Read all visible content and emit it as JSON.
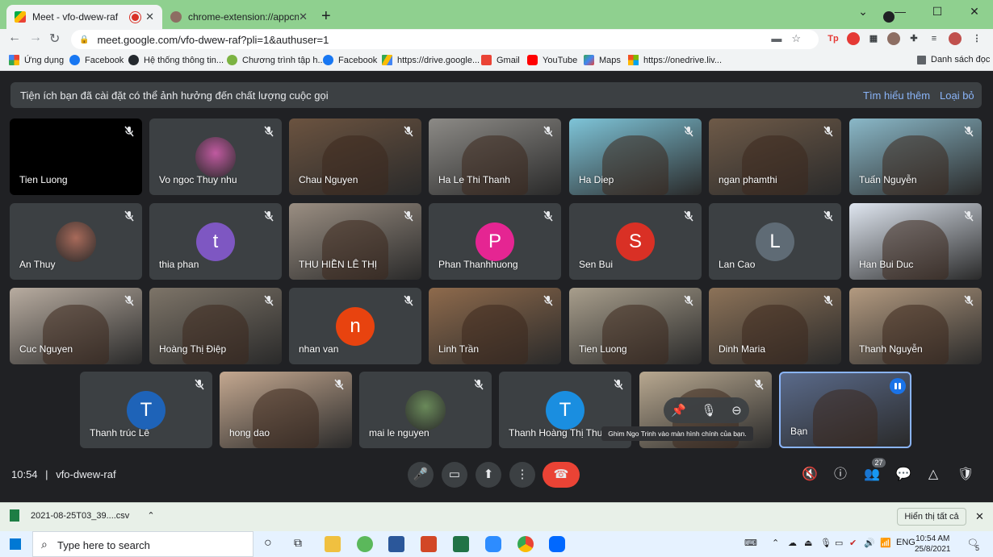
{
  "browser": {
    "tabs": [
      {
        "title": "Meet - vfo-dwew-raf",
        "icon": "meet-icon",
        "recording": true
      },
      {
        "title": "chrome-extension://appcnhiefoic",
        "icon": "extension-icon"
      }
    ],
    "url": "meet.google.com/vfo-dwew-raf?pli=1&authuser=1",
    "extension_labels": {
      "tp": "Tp"
    },
    "bookmarks": [
      {
        "label": "Ứng dụng",
        "icon": "apps-grid-icon",
        "color": "#ea4335"
      },
      {
        "label": "Facebook",
        "icon": "facebook-icon",
        "color": "#1877f2"
      },
      {
        "label": "Hệ thống thông tin...",
        "icon": "github-icon",
        "color": "#24292e"
      },
      {
        "label": "Chương trình tập h...",
        "icon": "leaf-icon",
        "color": "#7cb342"
      },
      {
        "label": "Facebook",
        "icon": "facebook-icon",
        "color": "#1877f2"
      },
      {
        "label": "https://drive.google...",
        "icon": "drive-icon",
        "color": "#fbbc04"
      },
      {
        "label": "Gmail",
        "icon": "gmail-icon",
        "color": "#ea4335"
      },
      {
        "label": "YouTube",
        "icon": "youtube-icon",
        "color": "#ff0000"
      },
      {
        "label": "Maps",
        "icon": "maps-icon",
        "color": "#34a853"
      },
      {
        "label": "https://onedrive.liv...",
        "icon": "microsoft-icon",
        "color": "#f25022"
      }
    ],
    "reading_list": "Danh sách đọc"
  },
  "meet": {
    "banner": {
      "message": "Tiện ích bạn đã cài đặt có thể ảnh hưởng đến chất lượng cuộc gọi",
      "learn_more": "Tìm hiểu thêm",
      "dismiss": "Loại bỏ"
    },
    "participants": [
      {
        "name": "Tien Luong",
        "kind": "black"
      },
      {
        "name": "Vo ngoc Thuy nhu",
        "kind": "photo",
        "color": "#c05aa0"
      },
      {
        "name": "Chau Nguyen",
        "kind": "video",
        "bg": "#6b5340"
      },
      {
        "name": "Ha Le Thi Thanh",
        "kind": "video",
        "bg": "#8c8a86"
      },
      {
        "name": "Ha Diep",
        "kind": "video",
        "bg": "#7ec4d8"
      },
      {
        "name": "ngan phamthi",
        "kind": "video",
        "bg": "#6e5a48"
      },
      {
        "name": "Tuấn Nguyễn",
        "kind": "video",
        "bg": "#8ab8c8"
      },
      {
        "name": "An Thuy",
        "kind": "photo",
        "color": "#a86a5a"
      },
      {
        "name": "thia phan",
        "kind": "letter",
        "letter": "t",
        "color": "#7e57c2"
      },
      {
        "name": "THU HIỀN LÊ THỊ",
        "kind": "video",
        "bg": "#9a8e82"
      },
      {
        "name": "Phan Thanhhuong",
        "kind": "letter",
        "letter": "P",
        "color": "#e52592"
      },
      {
        "name": "Sen Bui",
        "kind": "letter",
        "letter": "S",
        "color": "#d93025"
      },
      {
        "name": "Lan Cao",
        "kind": "letter",
        "letter": "L",
        "color": "#5f6b75"
      },
      {
        "name": "Han Bui Duc",
        "kind": "video",
        "bg": "#dfe6f0"
      },
      {
        "name": "Cuc Nguyen",
        "kind": "video",
        "bg": "#b8aca0"
      },
      {
        "name": "Hoàng Thị Điệp",
        "kind": "video",
        "bg": "#7d7468"
      },
      {
        "name": "nhan van",
        "kind": "letter",
        "letter": "n",
        "color": "#e8430f"
      },
      {
        "name": "Linh Trần",
        "kind": "video",
        "bg": "#8e6a4c"
      },
      {
        "name": "Tien Luong",
        "kind": "video",
        "bg": "#a89e8c"
      },
      {
        "name": "Dinh Maria",
        "kind": "video",
        "bg": "#8c7258"
      },
      {
        "name": "Thanh Nguyễn",
        "kind": "video",
        "bg": "#b39a80"
      },
      {
        "name": "Thanh trúc Lê",
        "kind": "letter",
        "letter": "T",
        "color": "#1e63b8"
      },
      {
        "name": "hong dao",
        "kind": "video",
        "bg": "#c4a890"
      },
      {
        "name": "mai le nguyen",
        "kind": "photo",
        "color": "#6a8a5a"
      },
      {
        "name": "Thanh Hoàng Thị Thu",
        "kind": "letter",
        "letter": "T",
        "color": "#1a8ee0"
      },
      {
        "name": "",
        "kind": "video",
        "bg": "#b8a890"
      },
      {
        "name": "Bạn",
        "kind": "video",
        "bg": "#5a6a8a",
        "self": true
      }
    ],
    "pin_tooltip": "Ghim Ngo Trinh vào màn hình chính của bạn.",
    "time": "10:54",
    "separator": "|",
    "meeting_code": "vfo-dwew-raf",
    "participant_count": "27"
  },
  "downloads": {
    "file": "2021-08-25T03_39....csv",
    "show_all": "Hiển thị tất cả"
  },
  "taskbar": {
    "search_placeholder": "Type here to search",
    "language": "ENG",
    "time": "10:54 AM",
    "date": "25/8/2021",
    "notification_count": "5"
  }
}
